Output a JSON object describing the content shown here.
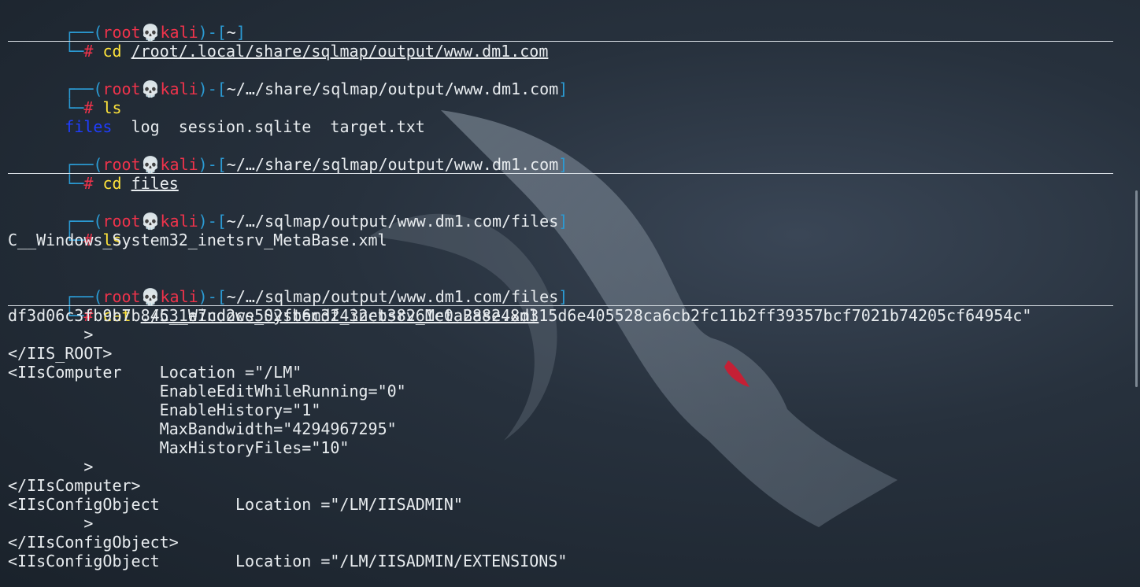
{
  "terminal": {
    "prompts": [
      {
        "user": "root",
        "host": "kali",
        "skull": "💀",
        "cwd": "~",
        "hash": "#",
        "cmd": "cd",
        "arg": "/root/.local/share/sqlmap/output/www.dm1.com"
      },
      {
        "user": "root",
        "host": "kali",
        "skull": "💀",
        "cwd": "~/…/share/sqlmap/output/www.dm1.com",
        "hash": "#",
        "cmd": "ls",
        "arg": ""
      },
      {
        "user": "root",
        "host": "kali",
        "skull": "💀",
        "cwd": "~/…/share/sqlmap/output/www.dm1.com",
        "hash": "#",
        "cmd": "cd",
        "arg": "files"
      },
      {
        "user": "root",
        "host": "kali",
        "skull": "💀",
        "cwd": "~/…/sqlmap/output/www.dm1.com/files",
        "hash": "#",
        "cmd": "ls",
        "arg": ""
      },
      {
        "user": "root",
        "host": "kali",
        "skull": "💀",
        "cwd": "~/…/sqlmap/output/www.dm1.com/files",
        "hash": "#",
        "cmd": "cat",
        "arg": "./C__Windows_System32_inetsrv_MetaBase.xml"
      }
    ],
    "ls_output_1": {
      "dir": "files",
      "rest": "  log  session.sqlite  target.txt"
    },
    "ls_output_2": "C__Windows_System32_inetsrv_MetaBase.xml",
    "cat_output": [
      "df3d06c3fb9b7b84531e7cd2ce502fb6cdf432cb38261c0a288248d315d6e405528ca6cb2fc11b2ff39357bcf7021b74205cf64954c\"",
      "        >",
      "</IIS_ROOT>",
      "<IIsComputer    Location =\"/LM\"",
      "                EnableEditWhileRunning=\"0\"",
      "                EnableHistory=\"1\"",
      "                MaxBandwidth=\"4294967295\"",
      "                MaxHistoryFiles=\"10\"",
      "        >",
      "</IIsComputer>",
      "<IIsConfigObject        Location =\"/LM/IISADMIN\"",
      "        >",
      "</IIsConfigObject>",
      "<IIsConfigObject        Location =\"/LM/IISADMIN/EXTENSIONS\""
    ]
  },
  "colors": {
    "frame": "#2b9bd4",
    "user": "#f0334b",
    "command": "#ffe43b",
    "directory": "#1f3dff",
    "text": "#e8ecef"
  }
}
